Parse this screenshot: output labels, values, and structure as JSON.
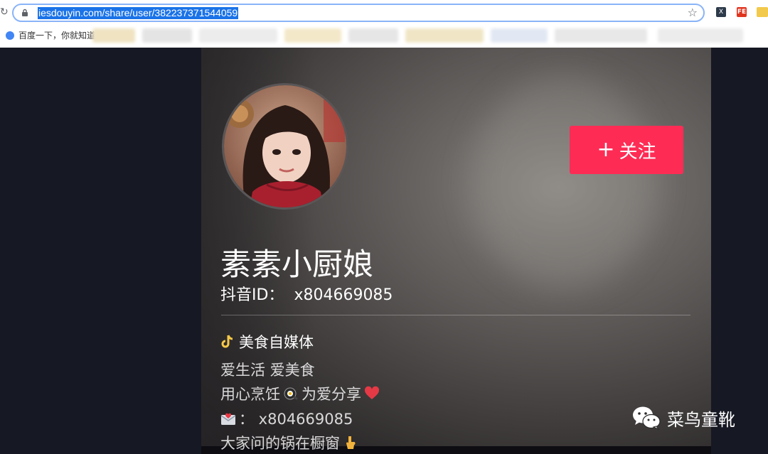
{
  "browser": {
    "url": "iesdouyin.com/share/user/382237371544059",
    "bookmark_first": "百度一下，你就知道",
    "ext_1": "X",
    "ext_2": "FE"
  },
  "profile": {
    "nickname": "素素小厨娘",
    "id_label": "抖音ID：",
    "id_value": "x804669085",
    "follow_label": "关注",
    "verified_text": "美食自媒体",
    "signature": {
      "line1": "爱生活 爱美食",
      "line2a": "用心烹饪",
      "line2b": "为爱分享",
      "line3": "：  x804669085",
      "line4": "大家问的锅在橱窗"
    }
  },
  "watermark": {
    "text": "菜鸟童靴"
  },
  "colors": {
    "follow": "#fe2c55",
    "background": "#161823",
    "url_highlight": "#1a73e8"
  }
}
